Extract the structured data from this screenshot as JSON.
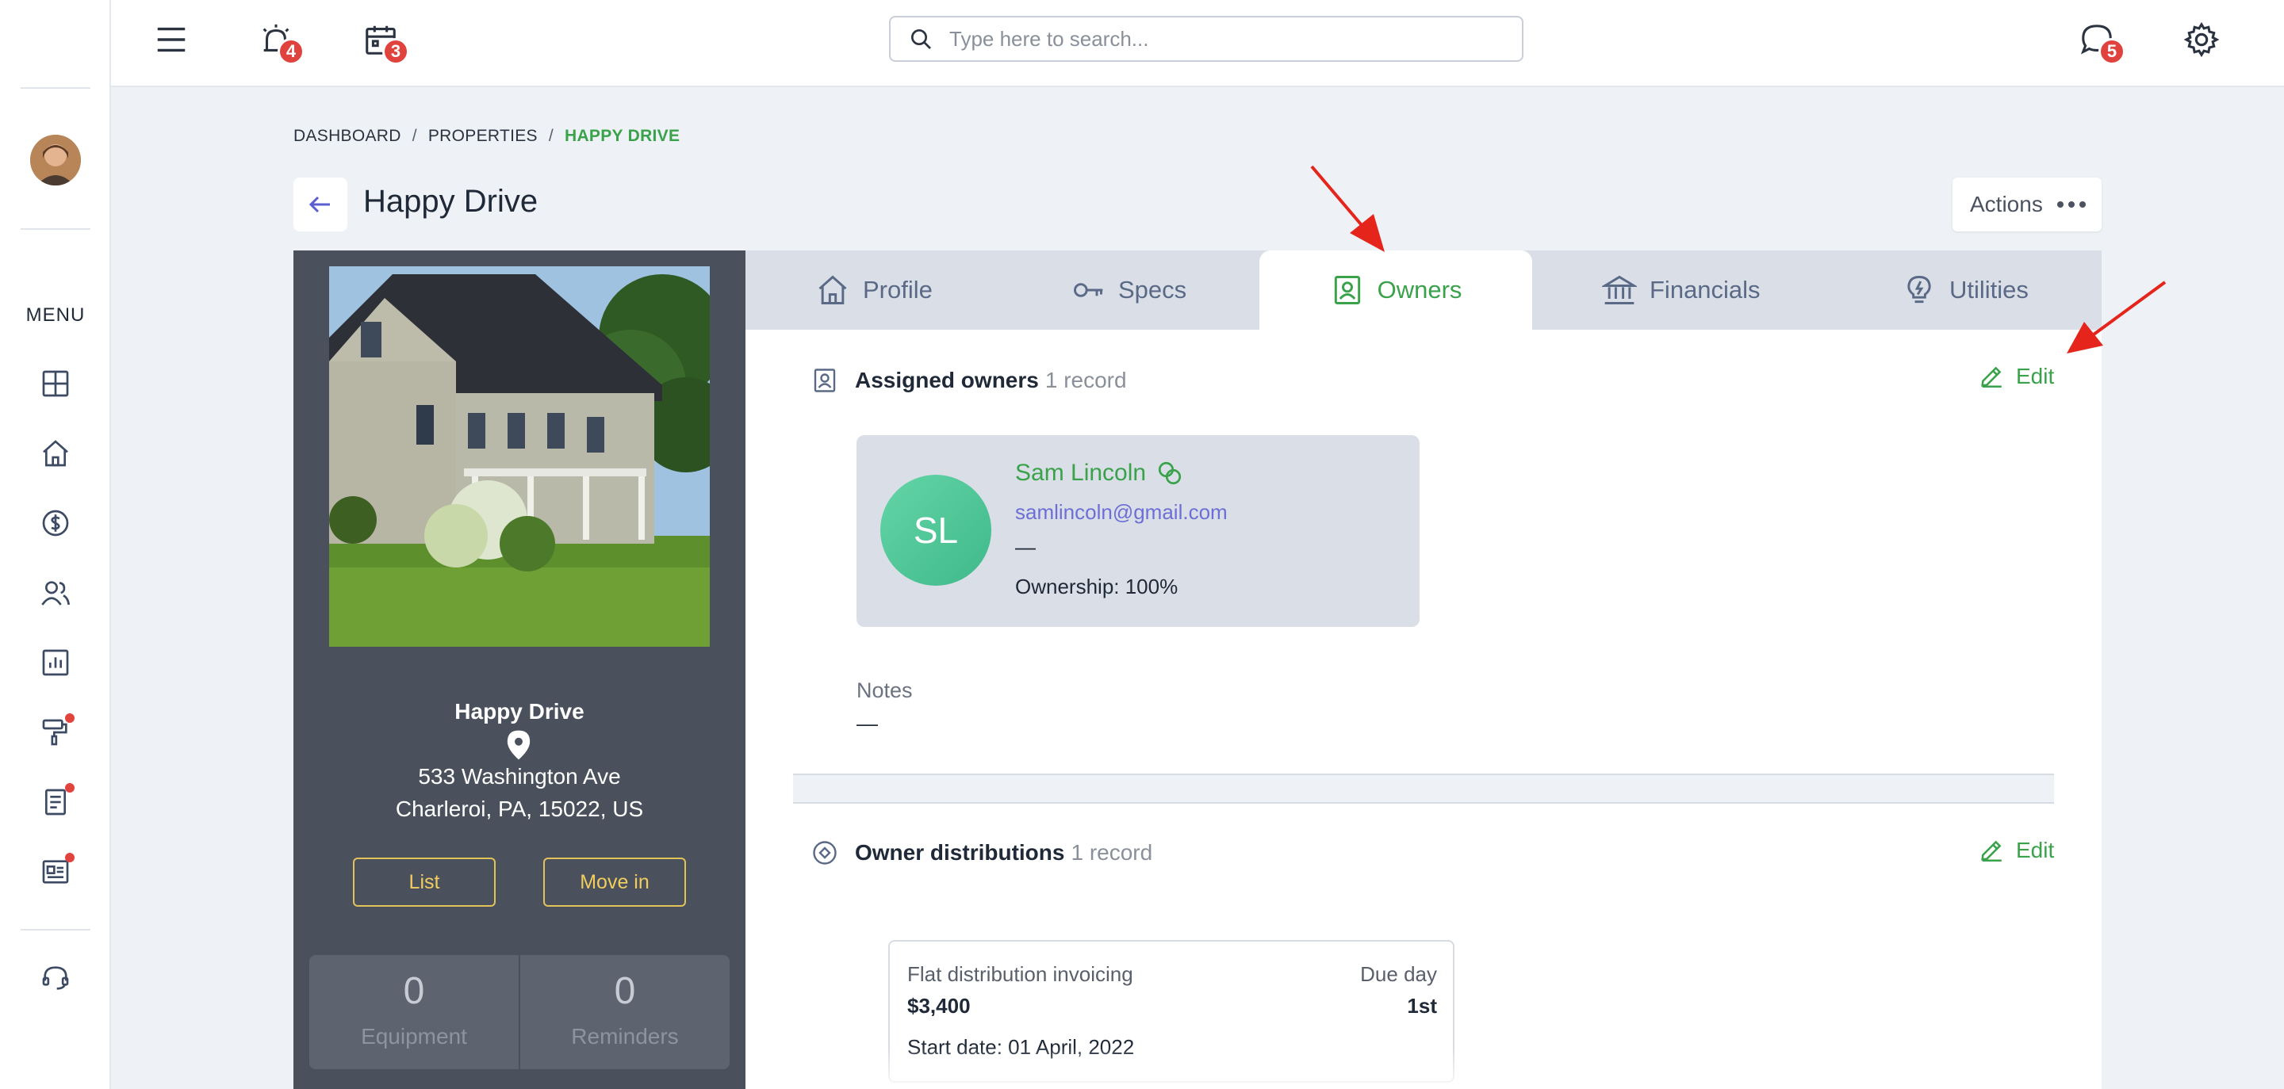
{
  "topbar": {
    "search_placeholder": "Type here to search...",
    "reminders_badge": "4",
    "calendar_badge": "3",
    "messages_badge": "5"
  },
  "sidebar": {
    "menu_label": "MENU",
    "items": [
      "dashboard",
      "properties",
      "accounting",
      "people",
      "reports",
      "maintenance",
      "tasks",
      "communication",
      "support"
    ]
  },
  "breadcrumb": {
    "items": [
      "DASHBOARD",
      "PROPERTIES",
      "HAPPY DRIVE"
    ],
    "separator": "/"
  },
  "page": {
    "title": "Happy Drive",
    "actions_label": "Actions"
  },
  "property": {
    "name": "Happy Drive",
    "address_line1": "533 Washington Ave",
    "address_line2": "Charleroi, PA, 15022, US",
    "list_button": "List",
    "move_in_button": "Move in",
    "stats": [
      {
        "value": "0",
        "label": "Equipment"
      },
      {
        "value": "0",
        "label": "Reminders"
      }
    ]
  },
  "tabs": [
    {
      "label": "Profile",
      "icon": "home-icon",
      "active": false
    },
    {
      "label": "Specs",
      "icon": "key-icon",
      "active": false
    },
    {
      "label": "Owners",
      "icon": "owner-badge-icon",
      "active": true
    },
    {
      "label": "Financials",
      "icon": "bank-icon",
      "active": false
    },
    {
      "label": "Utilities",
      "icon": "lightbulb-icon",
      "active": false
    }
  ],
  "owners_section": {
    "title": "Assigned owners",
    "count": "1 record",
    "edit_label": "Edit",
    "owner": {
      "initials": "SL",
      "name": "Sam Lincoln",
      "email": "samlincoln@gmail.com",
      "phone": "—",
      "ownership": "Ownership: 100%"
    },
    "notes_label": "Notes",
    "notes_value": "—"
  },
  "distributions_section": {
    "title": "Owner distributions",
    "count": "1 record",
    "edit_label": "Edit",
    "card": {
      "type": "Flat distribution invoicing",
      "due_label": "Due day",
      "amount": "$3,400",
      "due_value": "1st",
      "start_date": "Start date: 01 April, 2022"
    }
  },
  "colors": {
    "accent_green": "#3aa24a",
    "badge_red": "#e0433d",
    "annotation_arrow": "#e5241b",
    "property_card": "#4a515c",
    "button_yellow": "#e2c35a"
  }
}
